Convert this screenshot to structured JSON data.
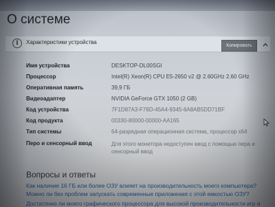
{
  "page": {
    "title": "О системе"
  },
  "device_specs": {
    "section_title": "Характеристики устройства",
    "copy_label": "Копировать",
    "rows": [
      {
        "label": "Имя устройства",
        "value": "DESKTOP-DL00SGI"
      },
      {
        "label": "Процессор",
        "value": "Intel(R) Xeon(R) CPU E5-2650 v2 @ 2.60GHz   2.60 GHz"
      },
      {
        "label": "Оперативная память",
        "value": "39,9 ГБ"
      },
      {
        "label": "Видеоадаптер",
        "value": "NVIDIA GeForce GTX 1050 (2 GB)"
      },
      {
        "label": "Код устройства",
        "value": "7F1D87A3-F76D-45A4-9345-6A8AB5DD71BF"
      },
      {
        "label": "Код продукта",
        "value": "00330-80000-00000-AA165"
      },
      {
        "label": "Тип системы",
        "value": "64-разрядная операционная система, процессор x64"
      },
      {
        "label": "Перо и сенсорный ввод",
        "value": "Для этого монитора недоступен ввод с помощью пера и сенсорный ввод"
      }
    ]
  },
  "faq": {
    "title": "Вопросы и ответы",
    "links": [
      "Как наличие 16 ГБ или более ОЗУ влияет на производительность моего компьютера?",
      "Можно ли без проблем запускать современные приложения с этой емкостью ОЗУ?",
      "Достаточно ли моего графического процессора для высокой производительности игр и"
    ]
  },
  "icons": {
    "info": "info-icon",
    "collapse": "chevron-up-icon",
    "cursor": "mouse-cursor-icon"
  },
  "colors": {
    "link": "#1f4f8a",
    "button": "#6e747c"
  }
}
